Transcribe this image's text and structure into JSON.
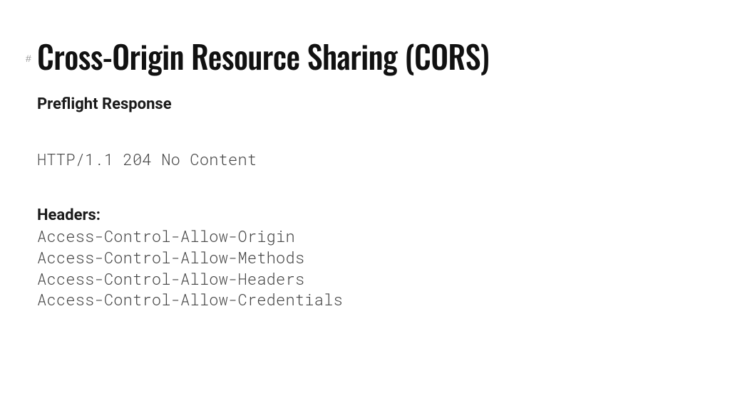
{
  "hash": "#",
  "title": "Cross-Origin Resource Sharing (CORS)",
  "subtitle": "Preflight Response",
  "status_line": "HTTP/1.1 204 No Content",
  "headers_label": "Headers:",
  "headers": [
    "Access-Control-Allow-Origin",
    "Access-Control-Allow-Methods",
    "Access-Control-Allow-Headers",
    "Access-Control-Allow-Credentials"
  ]
}
